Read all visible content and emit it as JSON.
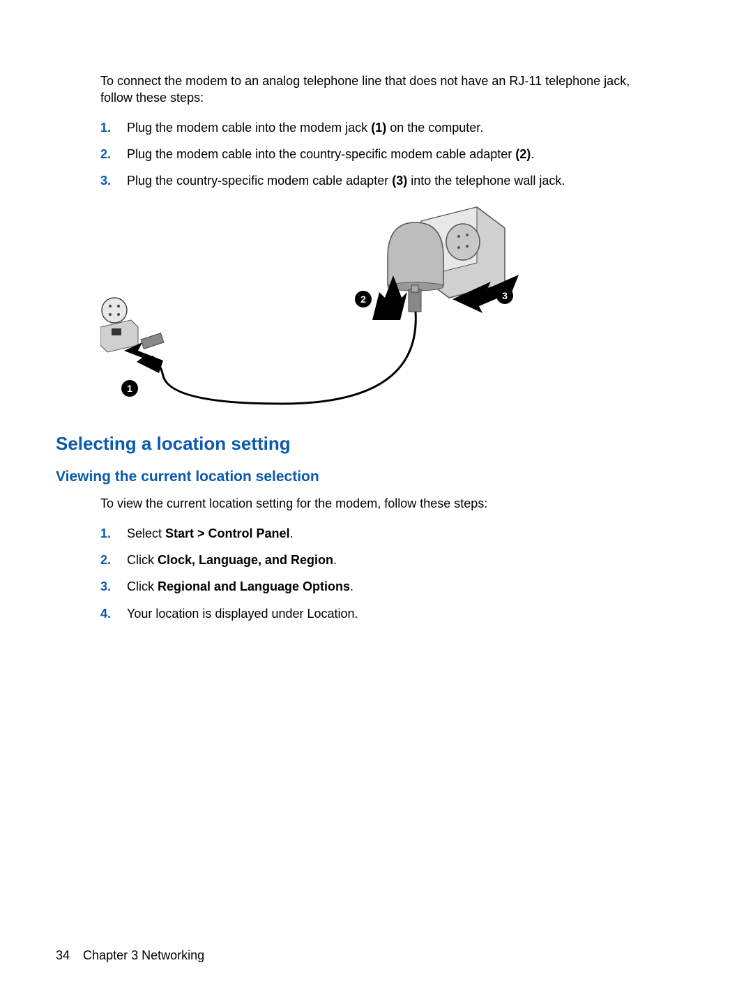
{
  "intro": "To connect the modem to an analog telephone line that does not have an RJ-11 telephone jack, follow these steps:",
  "steps1": [
    {
      "pre": "Plug the modem cable into the modem jack ",
      "b": "(1)",
      "post": " on the computer."
    },
    {
      "pre": "Plug the modem cable into the country-specific modem cable adapter ",
      "b": "(2)",
      "post": "."
    },
    {
      "pre": "Plug the country-specific modem cable adapter ",
      "b": "(3)",
      "post": " into the telephone wall jack."
    }
  ],
  "heading2": "Selecting a location setting",
  "heading3": "Viewing the current location selection",
  "intro2": "To view the current location setting for the modem, follow these steps:",
  "steps2": [
    {
      "pre": "Select ",
      "b": "Start > Control Panel",
      "post": "."
    },
    {
      "pre": "Click ",
      "b": "Clock, Language, and Region",
      "post": "."
    },
    {
      "pre": "Click ",
      "b": "Regional and Language Options",
      "post": "."
    },
    {
      "pre": "Your location is displayed under Location.",
      "b": "",
      "post": ""
    }
  ],
  "footer": {
    "page": "34",
    "chapter": "Chapter 3   Networking"
  },
  "callouts": {
    "c1": "1",
    "c2": "2",
    "c3": "3"
  }
}
